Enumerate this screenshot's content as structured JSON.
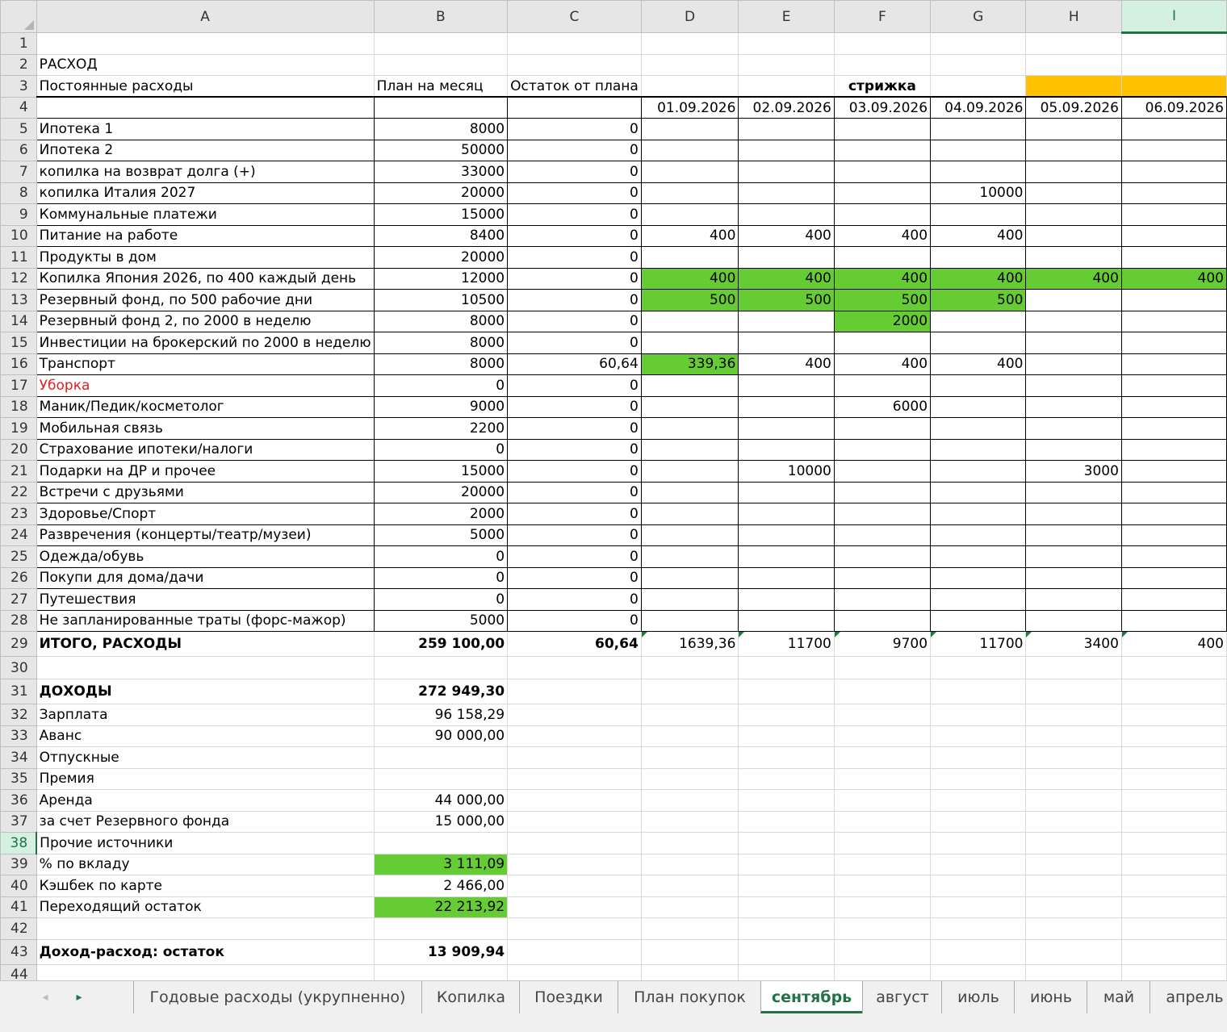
{
  "columns": [
    "A",
    "B",
    "C",
    "D",
    "E",
    "F",
    "G",
    "H",
    "I"
  ],
  "rows": [
    {
      "n": "1",
      "a": "",
      "b": "",
      "c": "",
      "d": "",
      "e": "",
      "f": "",
      "g": "",
      "h": "",
      "i": ""
    },
    {
      "n": "2",
      "a": "РАСХОД",
      "b": "",
      "c": "",
      "d": "",
      "e": "",
      "f": "",
      "g": "",
      "h": "",
      "i": ""
    },
    {
      "n": "3",
      "a": "Постоянные расходы",
      "b": "План на месяц",
      "c": "Остаток от плана",
      "d": "",
      "e": "",
      "f": "стрижка",
      "g": "",
      "h": "",
      "i": ""
    },
    {
      "n": "4",
      "a": "",
      "b": "",
      "c": "",
      "d": "01.09.2026",
      "e": "02.09.2026",
      "f": "03.09.2026",
      "g": "04.09.2026",
      "h": "05.09.2026",
      "i": "06.09.2026"
    },
    {
      "n": "5",
      "a": "Ипотека 1",
      "b": "8000",
      "c": "0",
      "d": "",
      "e": "",
      "f": "",
      "g": "",
      "h": "",
      "i": ""
    },
    {
      "n": "6",
      "a": "Ипотека 2",
      "b": "50000",
      "c": "0",
      "d": "",
      "e": "",
      "f": "",
      "g": "",
      "h": "",
      "i": ""
    },
    {
      "n": "7",
      "a": "копилка на возврат долга (+)",
      "b": "33000",
      "c": "0",
      "d": "",
      "e": "",
      "f": "",
      "g": "",
      "h": "",
      "i": ""
    },
    {
      "n": "8",
      "a": "копилка Италия 2027",
      "b": "20000",
      "c": "0",
      "d": "",
      "e": "",
      "f": "",
      "g": "10000",
      "h": "",
      "i": ""
    },
    {
      "n": "9",
      "a": "Коммунальные платежи",
      "b": "15000",
      "c": "0",
      "d": "",
      "e": "",
      "f": "",
      "g": "",
      "h": "",
      "i": ""
    },
    {
      "n": "10",
      "a": "Питание на работе",
      "b": "8400",
      "c": "0",
      "d": "400",
      "e": "400",
      "f": "400",
      "g": "400",
      "h": "",
      "i": ""
    },
    {
      "n": "11",
      "a": "Продукты в дом",
      "b": "20000",
      "c": "0",
      "d": "",
      "e": "",
      "f": "",
      "g": "",
      "h": "",
      "i": ""
    },
    {
      "n": "12",
      "a": "Копилка Япония 2026, по 400 каждый день",
      "b": "12000",
      "c": "0",
      "d": "400",
      "e": "400",
      "f": "400",
      "g": "400",
      "h": "400",
      "i": "400"
    },
    {
      "n": "13",
      "a": "Резервный фонд, по 500 рабочие дни",
      "b": "10500",
      "c": "0",
      "d": "500",
      "e": "500",
      "f": "500",
      "g": "500",
      "h": "",
      "i": ""
    },
    {
      "n": "14",
      "a": "Резервный фонд 2, по 2000 в неделю",
      "b": "8000",
      "c": "0",
      "d": "",
      "e": "",
      "f": "2000",
      "g": "",
      "h": "",
      "i": ""
    },
    {
      "n": "15",
      "a": "Инвестиции на брокерский по 2000 в неделю",
      "b": "8000",
      "c": "0",
      "d": "",
      "e": "",
      "f": "",
      "g": "",
      "h": "",
      "i": ""
    },
    {
      "n": "16",
      "a": "Транспорт",
      "b": "8000",
      "c": "60,64",
      "d": "339,36",
      "e": "400",
      "f": "400",
      "g": "400",
      "h": "",
      "i": ""
    },
    {
      "n": "17",
      "a": "Уборка",
      "b": "0",
      "c": "0",
      "d": "",
      "e": "",
      "f": "",
      "g": "",
      "h": "",
      "i": ""
    },
    {
      "n": "18",
      "a": "Маник/Педик/косметолог",
      "b": "9000",
      "c": "0",
      "d": "",
      "e": "",
      "f": "6000",
      "g": "",
      "h": "",
      "i": ""
    },
    {
      "n": "19",
      "a": "Мобильная связь",
      "b": "2200",
      "c": "0",
      "d": "",
      "e": "",
      "f": "",
      "g": "",
      "h": "",
      "i": ""
    },
    {
      "n": "20",
      "a": "Страхование ипотеки/налоги",
      "b": "0",
      "c": "0",
      "d": "",
      "e": "",
      "f": "",
      "g": "",
      "h": "",
      "i": ""
    },
    {
      "n": "21",
      "a": "Подарки на ДР и прочее",
      "b": "15000",
      "c": "0",
      "d": "",
      "e": "10000",
      "f": "",
      "g": "",
      "h": "3000",
      "i": ""
    },
    {
      "n": "22",
      "a": "Встречи с друзьями",
      "b": "20000",
      "c": "0",
      "d": "",
      "e": "",
      "f": "",
      "g": "",
      "h": "",
      "i": ""
    },
    {
      "n": "23",
      "a": "Здоровье/Спорт",
      "b": "2000",
      "c": "0",
      "d": "",
      "e": "",
      "f": "",
      "g": "",
      "h": "",
      "i": ""
    },
    {
      "n": "24",
      "a": "Развречения (концерты/театр/музеи)",
      "b": "5000",
      "c": "0",
      "d": "",
      "e": "",
      "f": "",
      "g": "",
      "h": "",
      "i": ""
    },
    {
      "n": "25",
      "a": "Одежда/обувь",
      "b": "0",
      "c": "0",
      "d": "",
      "e": "",
      "f": "",
      "g": "",
      "h": "",
      "i": ""
    },
    {
      "n": "26",
      "a": "Покупи для дома/дачи",
      "b": "0",
      "c": "0",
      "d": "",
      "e": "",
      "f": "",
      "g": "",
      "h": "",
      "i": ""
    },
    {
      "n": "27",
      "a": "Путешествия",
      "b": "0",
      "c": "0",
      "d": "",
      "e": "",
      "f": "",
      "g": "",
      "h": "",
      "i": ""
    },
    {
      "n": "28",
      "a": "Не запланированные траты (форс-мажор)",
      "b": "5000",
      "c": "0",
      "d": "",
      "e": "",
      "f": "",
      "g": "",
      "h": "",
      "i": ""
    },
    {
      "n": "29",
      "a": "ИТОГО, РАСХОДЫ",
      "b": "259 100,00",
      "c": "60,64",
      "d": "1639,36",
      "e": "11700",
      "f": "9700",
      "g": "11700",
      "h": "3400",
      "i": "400"
    },
    {
      "n": "30",
      "a": "",
      "b": "",
      "c": "",
      "d": "",
      "e": "",
      "f": "",
      "g": "",
      "h": "",
      "i": ""
    },
    {
      "n": "31",
      "a": "ДОХОДЫ",
      "b": "272 949,30",
      "c": "",
      "d": "",
      "e": "",
      "f": "",
      "g": "",
      "h": "",
      "i": ""
    },
    {
      "n": "32",
      "a": "Зарплата",
      "b": "96 158,29",
      "c": "",
      "d": "",
      "e": "",
      "f": "",
      "g": "",
      "h": "",
      "i": ""
    },
    {
      "n": "33",
      "a": "Аванс",
      "b": "90 000,00",
      "c": "",
      "d": "",
      "e": "",
      "f": "",
      "g": "",
      "h": "",
      "i": ""
    },
    {
      "n": "34",
      "a": "Отпускные",
      "b": "",
      "c": "",
      "d": "",
      "e": "",
      "f": "",
      "g": "",
      "h": "",
      "i": ""
    },
    {
      "n": "35",
      "a": "Премия",
      "b": "",
      "c": "",
      "d": "",
      "e": "",
      "f": "",
      "g": "",
      "h": "",
      "i": ""
    },
    {
      "n": "36",
      "a": "Аренда",
      "b": "44 000,00",
      "c": "",
      "d": "",
      "e": "",
      "f": "",
      "g": "",
      "h": "",
      "i": ""
    },
    {
      "n": "37",
      "a": "за счет Резервного фонда",
      "b": "15 000,00",
      "c": "",
      "d": "",
      "e": "",
      "f": "",
      "g": "",
      "h": "",
      "i": ""
    },
    {
      "n": "38",
      "a": "Прочие источники",
      "b": "",
      "c": "",
      "d": "",
      "e": "",
      "f": "",
      "g": "",
      "h": "",
      "i": ""
    },
    {
      "n": "39",
      "a": "% по вкладу",
      "b": "3 111,09",
      "c": "",
      "d": "",
      "e": "",
      "f": "",
      "g": "",
      "h": "",
      "i": ""
    },
    {
      "n": "40",
      "a": "Кэшбек по карте",
      "b": "2 466,00",
      "c": "",
      "d": "",
      "e": "",
      "f": "",
      "g": "",
      "h": "",
      "i": ""
    },
    {
      "n": "41",
      "a": "Переходящий остаток",
      "b": "22 213,92",
      "c": "",
      "d": "",
      "e": "",
      "f": "",
      "g": "",
      "h": "",
      "i": ""
    },
    {
      "n": "42",
      "a": "",
      "b": "",
      "c": "",
      "d": "",
      "e": "",
      "f": "",
      "g": "",
      "h": "",
      "i": ""
    },
    {
      "n": "43",
      "a": "Доход-расход: остаток",
      "b": "13 909,94",
      "c": "",
      "d": "",
      "e": "",
      "f": "",
      "g": "",
      "h": "",
      "i": ""
    },
    {
      "n": "44",
      "a": "",
      "b": "",
      "c": "",
      "d": "",
      "e": "",
      "f": "",
      "g": "",
      "h": "",
      "i": ""
    }
  ],
  "selection": {
    "row": "38",
    "column": "I"
  },
  "colors": {
    "green_fill": "#66cc33",
    "orange_fill": "#ffc000",
    "red_text": "#e0201f",
    "excel_green": "#217346"
  },
  "tabs": [
    "Годовые расходы (укрупненно)",
    "Копилка",
    "Поездки",
    "План покупок",
    "сентябрь",
    "август",
    "июль",
    "июнь",
    "май",
    "апрель"
  ],
  "active_tab": "сентябрь",
  "nav": {
    "prev_icon": "◂",
    "next_icon": "▸"
  }
}
